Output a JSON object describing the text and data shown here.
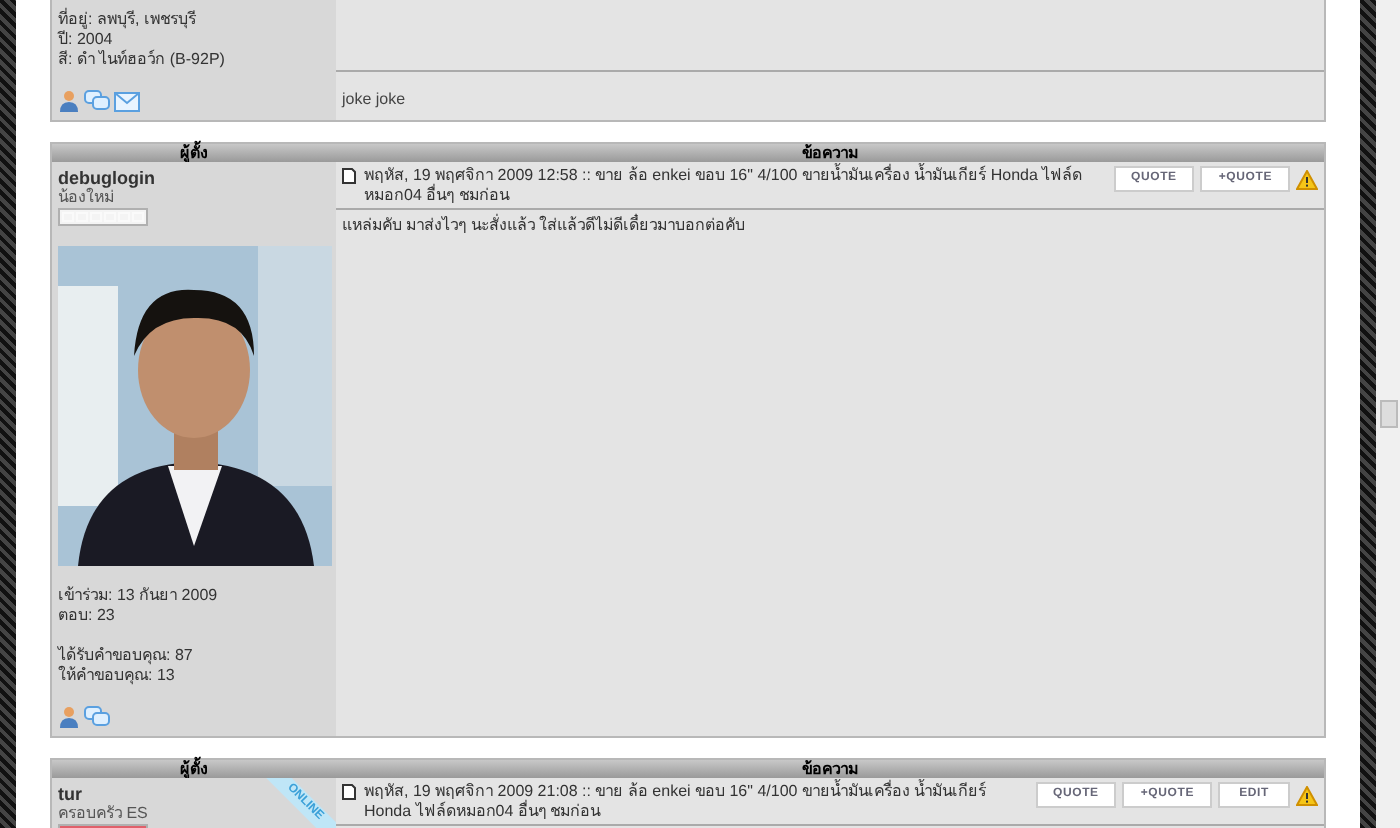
{
  "posts": [
    {
      "author": {
        "details": [
          [
            "ที่อยู่: ลพบุรี, เพชรบุรี",
            "ปี: 2004",
            "สี: ดำ ไนท์ฮอว์ก (B-92P)"
          ]
        ],
        "contact_icons": [
          {
            "kind": "profile"
          },
          {
            "kind": "pm"
          },
          {
            "kind": "email"
          }
        ]
      },
      "signature": "joke joke"
    },
    {
      "header": {
        "author_col": "ผู้ตั้ง",
        "message_col": "ข้อความ"
      },
      "author": {
        "username": "debuglogin",
        "rank": "น้องใหม่",
        "rank_bar": {
          "color": "#f4f4f4"
        },
        "online": false,
        "avatar": {
          "kind": "picture"
        },
        "details": [
          [
            "เข้าร่วม: 13 กันยา 2009",
            "ตอบ: 23"
          ],
          [
            "ได้รับคำขอบคุณ: 87",
            "ให้คำขอบคุณ: 13"
          ]
        ],
        "contact_icons": [
          {
            "kind": "profile"
          },
          {
            "kind": "pm"
          }
        ]
      },
      "subject": "พฤหัส, 19 พฤศจิกา 2009 12:58 :: ขาย ล้อ enkei ขอบ 16\" 4/100 ขายน้ำมันเครื่อง น้ำมันเกียร์ Honda ไฟล์ดหมอก04 อื่นๆ ชมก่อน",
      "buttons": [
        "QUOTE",
        "+QUOTE"
      ],
      "body": "แหล่มคับ มาส่งไวๆ นะสั่งแล้ว ใส่แล้วดีไม่ดีเดี๋ยวมาบอกต่อคับ"
    },
    {
      "header": {
        "author_col": "ผู้ตั้ง",
        "message_col": "ข้อความ"
      },
      "author": {
        "username": "tur",
        "rank": "ครอบครัว ES",
        "rank_bar": {
          "color": "#e0606a"
        },
        "online": true,
        "online_label": "ONLINE"
      },
      "subject": "พฤหัส, 19 พฤศจิกา 2009 21:08 :: ขาย ล้อ enkei ขอบ 16\" 4/100 ขายน้ำมันเครื่อง น้ำมันเกียร์ Honda ไฟล์ดหมอก04 อื่นๆ ชมก่อน",
      "buttons": [
        "QUOTE",
        "+QUOTE",
        "EDIT"
      ]
    }
  ]
}
